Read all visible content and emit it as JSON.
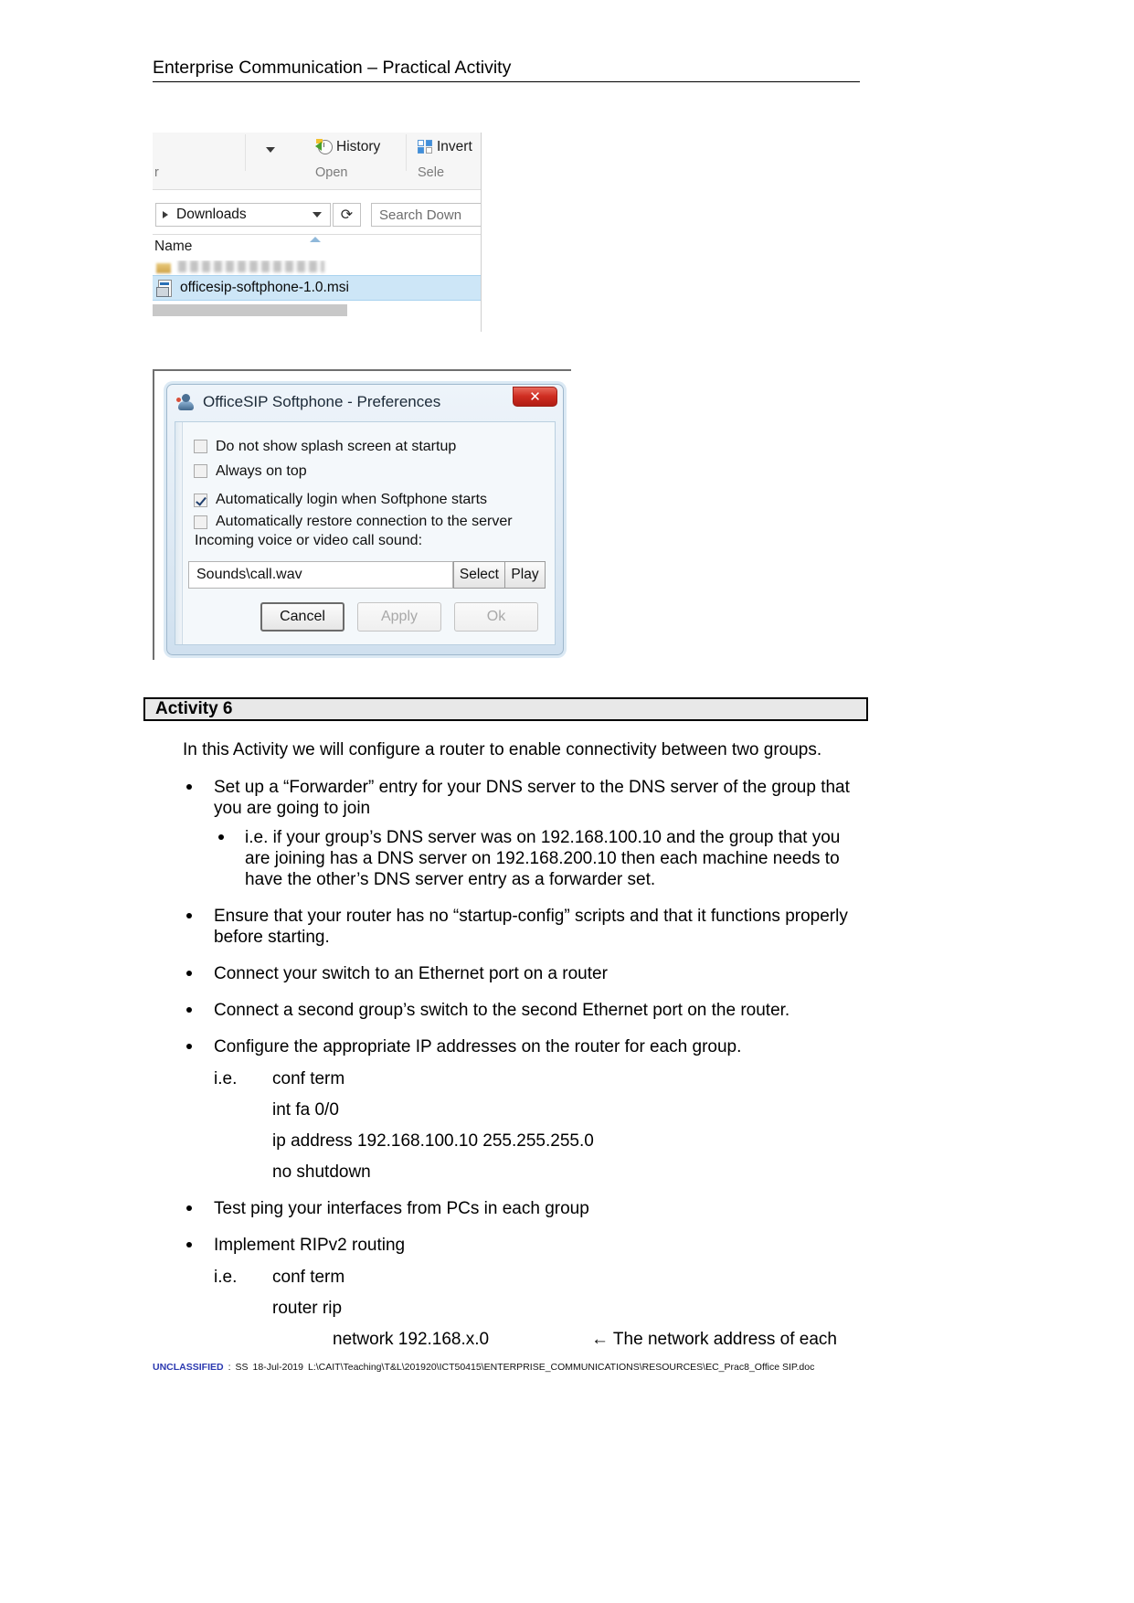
{
  "header": {
    "title": "Enterprise Communication – Practical Activity"
  },
  "explorer_screenshot": {
    "ribbon": {
      "history_label": "History",
      "invert_label": "Invert",
      "group_open": "Open",
      "group_select": "Sele",
      "left_fragment": "r"
    },
    "address_bar": {
      "path": "Downloads",
      "refresh_glyph": "⟳",
      "search_placeholder": "Search Down"
    },
    "column_header": "Name",
    "selected_file": "officesip-softphone-1.0.msi"
  },
  "prefs_dialog": {
    "title": "OfficeSIP Softphone - Preferences",
    "close_glyph": "✕",
    "checkboxes": [
      {
        "label": "Do not show splash screen at startup",
        "checked": false
      },
      {
        "label": "Always on top",
        "checked": false
      },
      {
        "label": "Automatically login when Softphone starts",
        "checked": true
      },
      {
        "label": "Automatically restore connection to the server",
        "checked": false
      }
    ],
    "sound_label": "Incoming voice or video call sound:",
    "sound_path": "Sounds\\call.wav",
    "select_button": "Select",
    "play_button": "Play",
    "cancel_button": "Cancel",
    "apply_button": "Apply",
    "ok_button": "Ok"
  },
  "activity": {
    "heading": "Activity 6",
    "intro": "In this Activity we will configure a router to enable connectivity between two groups.",
    "bullets": [
      {
        "text": "Set up a “Forwarder” entry for your DNS server to the DNS server of the group that you are going to join",
        "sub": [
          "i.e. if your group’s DNS server was on 192.168.100.10 and the group that you are joining has a DNS server on 192.168.200.10 then each machine needs to have the other’s DNS server entry as a forwarder set."
        ]
      },
      {
        "text": "Ensure that your router has no “startup-config” scripts and that it functions properly before starting."
      },
      {
        "text": "Connect your switch to an Ethernet port on a router"
      },
      {
        "text": "Connect a second group’s switch to the second Ethernet port on the router."
      },
      {
        "text": "Configure the appropriate IP addresses on the router for each group."
      },
      {
        "text": "Test ping your interfaces from PCs in each group"
      },
      {
        "text": "Implement RIPv2 routing"
      }
    ],
    "config_block_1": {
      "ie_label": "i.e.",
      "first_command": "conf term",
      "commands": [
        "int fa 0/0",
        "ip address 192.168.100.10 255.255.255.0",
        "no shutdown"
      ]
    },
    "config_block_2": {
      "ie_label": "i.e.",
      "first_command": "conf term",
      "commands": [
        "router rip"
      ],
      "network_command": "network 192.168.x.0",
      "network_note": "← The network address of each"
    }
  },
  "footer": {
    "classification": "UNCLASSIFIED",
    "separator": ":",
    "initials": "SS",
    "date": "18-Jul-2019",
    "path": "L:\\CAIT\\Teaching\\T&L\\201920\\ICT50415\\ENTERPRISE_COMMUNICATIONS\\RESOURCES\\EC_Prac8_Office SIP.doc"
  }
}
